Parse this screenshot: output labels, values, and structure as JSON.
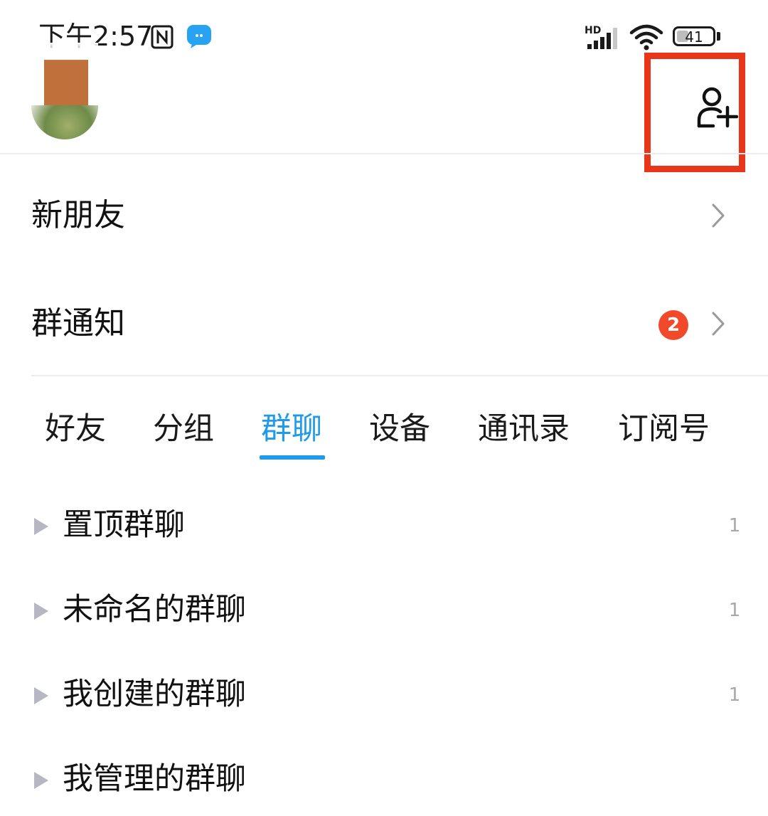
{
  "status_bar": {
    "time": "下午2:57",
    "network_label": "HD",
    "battery_percent": "41",
    "icons": [
      "nfc-icon",
      "message-app-icon",
      "signal-icon",
      "wifi-icon",
      "battery-icon"
    ]
  },
  "header": {
    "avatar": "avatar",
    "add_friend_icon": "add-friend-icon",
    "highlight_color": "#e8361a"
  },
  "menu": {
    "new_friends": {
      "label": "新朋友"
    },
    "group_notice": {
      "label": "群通知",
      "badge": "2"
    }
  },
  "tabs": [
    {
      "label": "好友"
    },
    {
      "label": "分组"
    },
    {
      "label": "群聊",
      "active": true
    },
    {
      "label": "设备"
    },
    {
      "label": "通讯录"
    },
    {
      "label": "订阅号"
    }
  ],
  "groups": [
    {
      "label": "置顶群聊",
      "count": "1"
    },
    {
      "label": "未命名的群聊",
      "count": "1"
    },
    {
      "label": "我创建的群聊",
      "count": "1"
    },
    {
      "label": "我管理的群聊",
      "count": ""
    }
  ],
  "colors": {
    "accent": "#1f9be9",
    "badge": "#f2492b",
    "count_text": "#a8a8a8"
  }
}
